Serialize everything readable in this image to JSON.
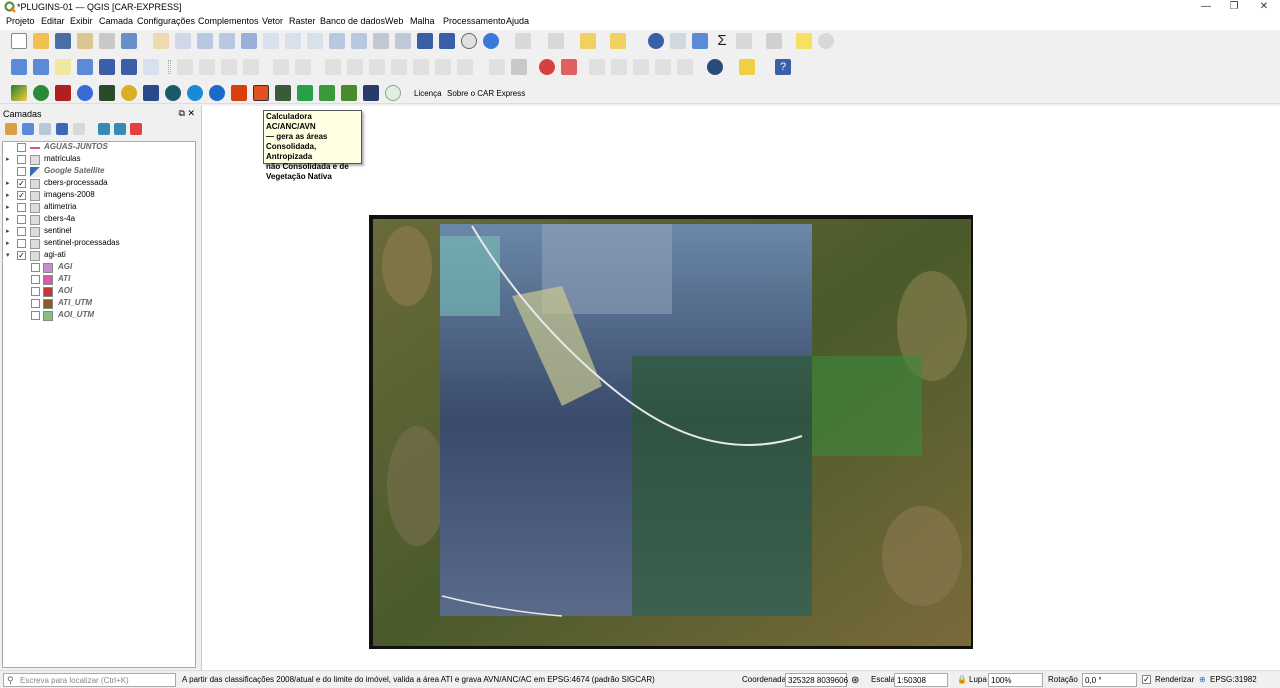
{
  "window": {
    "title": "*PLUGINS-01 — QGIS [CAR-EXPRESS]",
    "minimize": "—",
    "restore": "❐",
    "close": "✕"
  },
  "menu": [
    "Projeto",
    "Editar",
    "Exibir",
    "Camada",
    "Configurações",
    "Complementos",
    "Vetor",
    "Raster",
    "Banco de dados",
    "Web",
    "Malha",
    "Processamento",
    "Ajuda"
  ],
  "plugin_toolbar": {
    "license_label": "Licença",
    "about_label": "Sobre o CAR Express"
  },
  "tooltip": {
    "text_lines": [
      "Calculadora AC/ANC/AVN",
      "— gera as áreas",
      "Consolidada, Antropizada",
      "não Consolidada e de",
      "Vegetação Nativa"
    ]
  },
  "layers_panel": {
    "title": "Camadas",
    "float_icon": "⧉",
    "close_icon": "✕",
    "layers": [
      {
        "name": "AGUAS-JUNTOS",
        "checked": false,
        "expand": false,
        "icon": "line-icon",
        "style": "italic",
        "color": "#e05a6a"
      },
      {
        "name": "matriculas",
        "checked": false,
        "expand": true,
        "icon": "group-icon"
      },
      {
        "name": "Google Satellite",
        "checked": false,
        "expand": false,
        "icon": "xyz-tile-icon",
        "style": "italic"
      },
      {
        "name": "cbers-processada",
        "checked": true,
        "expand": true,
        "icon": "group-icon"
      },
      {
        "name": "imagens-2008",
        "checked": true,
        "expand": true,
        "icon": "group-icon"
      },
      {
        "name": "altimetria",
        "checked": false,
        "expand": true,
        "icon": "group-icon"
      },
      {
        "name": "cbers-4a",
        "checked": false,
        "expand": true,
        "icon": "group-icon"
      },
      {
        "name": "sentinel",
        "checked": false,
        "expand": true,
        "icon": "group-icon"
      },
      {
        "name": "sentinel-processadas",
        "checked": false,
        "expand": true,
        "icon": "group-icon"
      },
      {
        "name": "agi-ati",
        "checked": true,
        "expand": true,
        "expanded": true,
        "icon": "group-icon"
      }
    ],
    "sublayers": [
      {
        "name": "AGI",
        "color": "#c88ad0"
      },
      {
        "name": "ATI",
        "color": "#d85aa0"
      },
      {
        "name": "AOI",
        "color": "#c03838"
      },
      {
        "name": "ATI_UTM",
        "color": "#8a5a2a"
      },
      {
        "name": "AOI_UTM",
        "color": "#88c080"
      }
    ]
  },
  "statusbar": {
    "search_placeholder": "Escreva para localizar (Ctrl+K)",
    "message": "A partir das classificações 2008/atual e do limite do imóvel, valida a área ATI e grava AVN/ANC/AC em EPSG:4674 (padrão SIGCAR)",
    "coord_label": "Coordenada",
    "coord_value": "325328  8039606",
    "scale_label": "Escala",
    "scale_value": "1:50308",
    "magnifier_label": "Lupa",
    "magnifier_value": "100%",
    "rotation_label": "Rotação",
    "rotation_value": "0,0 °",
    "render_label": "Renderizar",
    "crs_label": "EPSG:31982"
  },
  "colors": {
    "accent": "#589632",
    "tooltip_bg": "#ffffe1"
  }
}
